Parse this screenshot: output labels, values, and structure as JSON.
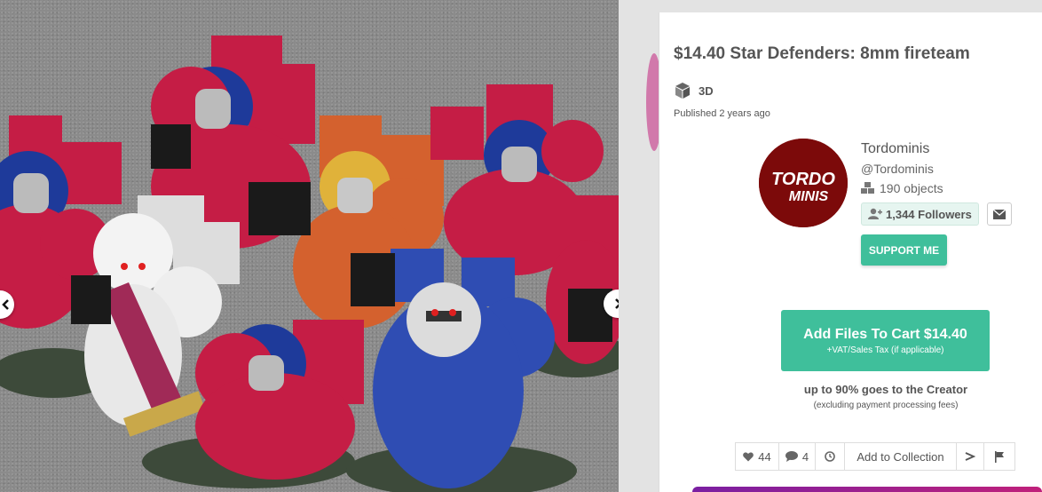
{
  "product": {
    "title": "$14.40 Star Defenders: 8mm fireteam",
    "type_label": "3D",
    "published": "Published 2 years ago"
  },
  "creator": {
    "name": "Tordominis",
    "handle": "@Tordominis",
    "objects": "190 objects",
    "followers": "1,344 Followers",
    "support_label": "SUPPORT ME",
    "logo_text_top": "TORDO",
    "logo_text_bottom": "MINIS"
  },
  "cart": {
    "label": "Add Files To Cart $14.40",
    "sub": "+VAT/Sales Tax (if applicable)"
  },
  "creator_share": {
    "main": "up to 90% goes to the Creator",
    "sub": "(excluding payment processing fees)"
  },
  "actions": {
    "likes": "44",
    "comments": "4",
    "collection": "Add to Collection"
  },
  "colors": {
    "accent": "#3fbf9b",
    "avatar_bg": "#7c0a0a",
    "model_red": "#c51d45",
    "model_blue": "#2f4db3",
    "model_orange": "#d4612e"
  },
  "icons": {
    "prev": "chevron-left-icon",
    "next": "chevron-right-icon",
    "type": "cube-icon",
    "objects": "cubes-icon",
    "followers": "user-plus-icon",
    "message": "envelope-icon",
    "like": "heart-icon",
    "comment": "comment-icon",
    "history": "clock-icon",
    "share": "share-icon",
    "report": "flag-icon"
  }
}
